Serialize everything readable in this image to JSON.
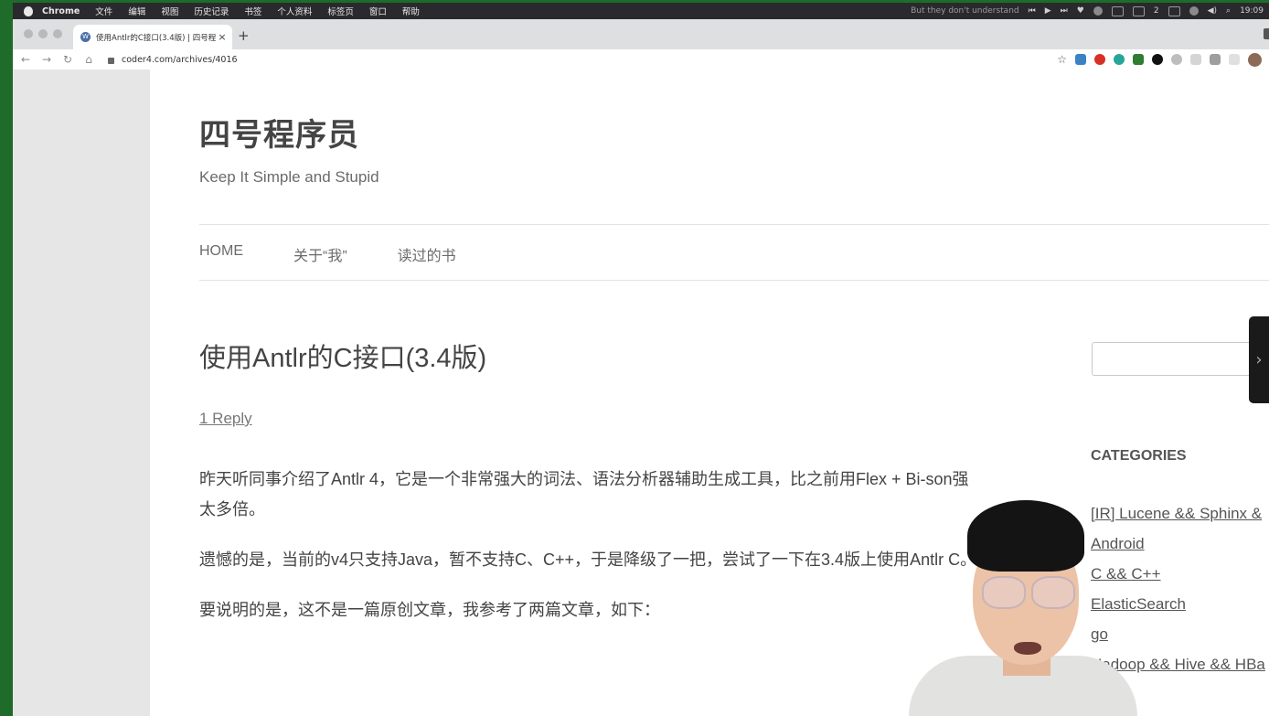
{
  "menubar": {
    "app_name": "Chrome",
    "items": [
      "文件",
      "编辑",
      "视图",
      "历史记录",
      "书签",
      "个人资料",
      "标签页",
      "窗口",
      "帮助"
    ],
    "now_playing": "But they don't understand",
    "notification_count": "2",
    "clock": "19:09"
  },
  "tab": {
    "title": "使用Antlr的C接口(3.4版) | 四号程",
    "close_glyph": "×",
    "new_tab_glyph": "+"
  },
  "toolbar": {
    "url": "coder4.com/archives/4016"
  },
  "site": {
    "title": "四号程序员",
    "description": "Keep It Simple and Stupid",
    "nav": [
      "HOME",
      "关于“我”",
      "读过的书"
    ]
  },
  "post": {
    "title": "使用Antlr的C接口(3.4版)",
    "reply_link": "1 Reply",
    "paragraphs": [
      "昨天听同事介绍了Antlr 4，它是一个非常强大的词法、语法分析器辅助生成工具，比之前用Flex + Bi-son强太多倍。",
      "遗憾的是，当前的v4只支持Java，暂不支持C、C++，于是降级了一把，尝试了一下在3.4版上使用Antlr C。",
      "要说明的是，这不是一篇原创文章，我参考了两篇文章，如下："
    ]
  },
  "sidebar": {
    "categories_heading": "CATEGORIES",
    "categories": [
      "[IR] Lucene && Sphinx &",
      "Android",
      "C && C++",
      "ElasticSearch",
      "go",
      "Hadoop && Hive && HBa"
    ]
  },
  "icons": {
    "drawer": "chevron-right-icon"
  }
}
